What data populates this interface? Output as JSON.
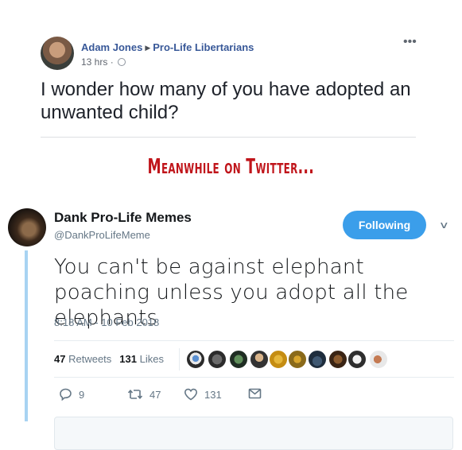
{
  "facebook_post": {
    "author": "Adam Jones",
    "group": "Pro-Life Libertarians",
    "time": "13 hrs",
    "more_icon": "ellipsis-icon",
    "text": "I wonder how many of you have adopted an unwanted child?"
  },
  "meme_caption": "Meanwhile on Twitter...",
  "tweet": {
    "display_name": "Dank Pro-Life Memes",
    "handle": "@DankProLifeMeme",
    "follow_label": "Following",
    "text": "You can't be against elephant poaching unless you adopt all the elephants",
    "timestamp": "8:18 AM - 10 Feb 2018",
    "retweets_count": "47",
    "retweets_label": "Retweets",
    "likes_count": "131",
    "likes_label": "Likes",
    "actions": {
      "reply_count": "9",
      "retweet_count": "47",
      "like_count": "131"
    }
  },
  "colors": {
    "facebook_link": "#385898",
    "caption_red": "#c0151b",
    "twitter_blue": "#3b9eea",
    "thread_line": "#a8d3f2"
  }
}
